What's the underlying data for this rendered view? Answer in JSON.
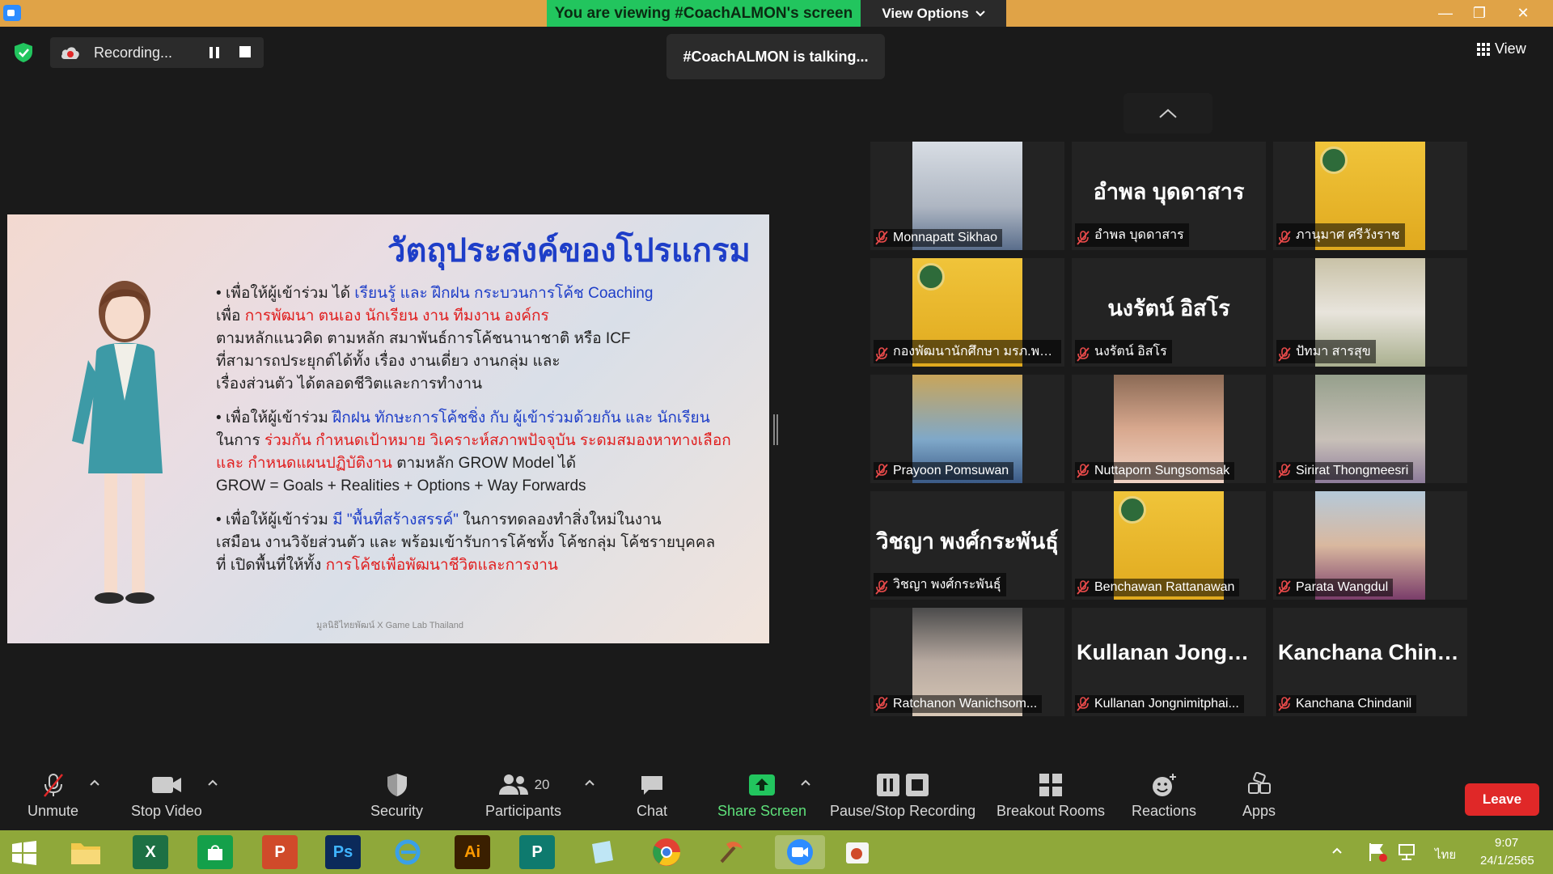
{
  "window": {
    "viewing_banner": "You are viewing #CoachALMON's screen",
    "view_options": "View Options",
    "minimize": "—",
    "restore": "❐",
    "close": "✕"
  },
  "overlay": {
    "recording": "Recording...",
    "talking": "#CoachALMON is talking...",
    "view": "View"
  },
  "slide": {
    "title": "วัตถุประสงค์ของโปรแกรม",
    "p1": [
      {
        "t": "• เพื่อให้ผู้เข้าร่วม ได้ ",
        "c": ""
      },
      {
        "t": "เรียนรู้ และ ฝึกฝน กระบวนการโค้ช Coaching",
        "c": "blue"
      },
      {
        "t": "\nเพื่อ ",
        "c": ""
      },
      {
        "t": "การพัฒนา ตนเอง นักเรียน งาน ทีมงาน องค์กร",
        "c": "red"
      },
      {
        "t": "\nตามหลักแนวคิด ตามหลัก สมาพันธ์การโค้ชนานาชาติ หรือ ICF\nที่สามารถประยุกต์ได้ทั้ง เรื่อง งานเดี่ยว งานกลุ่ม และ\nเรื่องส่วนตัว ได้ตลอดชีวิตและการทำงาน",
        "c": ""
      }
    ],
    "p2": [
      {
        "t": "• เพื่อให้ผู้เข้าร่วม ",
        "c": ""
      },
      {
        "t": "ฝึกฝน ทักษะการโค้ชชิ่ง กับ ผู้เข้าร่วมด้วยกัน และ นักเรียน",
        "c": "blue"
      },
      {
        "t": "\nในการ ",
        "c": ""
      },
      {
        "t": "ร่วมกัน กำหนดเป้าหมาย วิเคราะห์สภาพปัจจุบัน ระดมสมองหาทางเลือก\nและ กำหนดแผนปฏิบัติงาน",
        "c": "red"
      },
      {
        "t": " ตามหลัก GROW Model ได้\nGROW = Goals + Realities + Options + Way Forwards",
        "c": ""
      }
    ],
    "p3": [
      {
        "t": "• เพื่อให้ผู้เข้าร่วม ",
        "c": ""
      },
      {
        "t": "มี \"พื้นที่สร้างสรรค์\"",
        "c": "blue"
      },
      {
        "t": " ในการทดลองทำสิ่งใหม่ในงาน\nเสมือน งานวิจัยส่วนตัว และ พร้อมเข้ารับการโค้ชทั้ง โค้ชกลุ่ม โค้ชรายบุคคล\nที่ เปิดพื้นที่ให้ทั้ง ",
        "c": ""
      },
      {
        "t": "การโค้ชเพื่อพัฒนาชีวิตและการงาน",
        "c": "red"
      }
    ],
    "footer": "มูลนิธิไทยพัฒน์ X Game Lab Thailand"
  },
  "participants": [
    {
      "name": "Monnapatt Sikhao",
      "photo": "ph-blue",
      "big": ""
    },
    {
      "name": "อำพล บุดดาสาร",
      "photo": "",
      "big": "อำพล บุดดาสาร"
    },
    {
      "name": "ภานุมาศ ศรีวังราช",
      "photo": "ph-gold",
      "big": ""
    },
    {
      "name": "กองพัฒนานักศึกษา มรภ.พร...",
      "photo": "ph-gold",
      "big": ""
    },
    {
      "name": "นงรัตน์ อิสโร",
      "photo": "",
      "big": "นงรัตน์ อิสโร"
    },
    {
      "name": "ปัทมา สารสุข",
      "photo": "ph-uniform",
      "big": ""
    },
    {
      "name": "Prayoon Pomsuwan",
      "photo": "ph-crowd",
      "big": ""
    },
    {
      "name": "Nuttaporn Sungsomsak",
      "photo": "ph-face",
      "big": ""
    },
    {
      "name": "Sirirat Thongmeesri",
      "photo": "ph-family",
      "big": ""
    },
    {
      "name": "วิชญา พงศ์กระพันธุ์",
      "photo": "",
      "big": "วิชญา พงศ์กระพันธุ์"
    },
    {
      "name": "Benchawan Rattanawan",
      "photo": "ph-gold",
      "big": ""
    },
    {
      "name": "Parata Wangdul",
      "photo": "ph-lady",
      "big": ""
    },
    {
      "name": "Ratchanon Wanichsom...",
      "photo": "ph-food",
      "big": ""
    },
    {
      "name": "Kullanan Jongnimitphai...",
      "photo": "",
      "big": "Kullanan Jongni..."
    },
    {
      "name": "Kanchana Chindanil",
      "photo": "",
      "big": "Kanchana Chind..."
    }
  ],
  "toolbar": {
    "unmute": "Unmute",
    "stop_video": "Stop Video",
    "security": "Security",
    "participants": "Participants",
    "participants_count": "20",
    "chat": "Chat",
    "share_screen": "Share Screen",
    "pause_stop_recording": "Pause/Stop Recording",
    "breakout_rooms": "Breakout Rooms",
    "reactions": "Reactions",
    "apps": "Apps",
    "leave": "Leave"
  },
  "taskbar": {
    "excel": "X",
    "powerpoint": "P",
    "photoshop": "Ps",
    "illustrator": "Ai",
    "publisher": "P",
    "lang": "ไทย",
    "time": "9:07",
    "date": "24/1/2565"
  },
  "colors": {
    "titlebar": "#e0a347",
    "banner": "#22c55e",
    "leave": "#e02828",
    "share_green": "#22c55e",
    "taskbar": "#8fa83a"
  }
}
